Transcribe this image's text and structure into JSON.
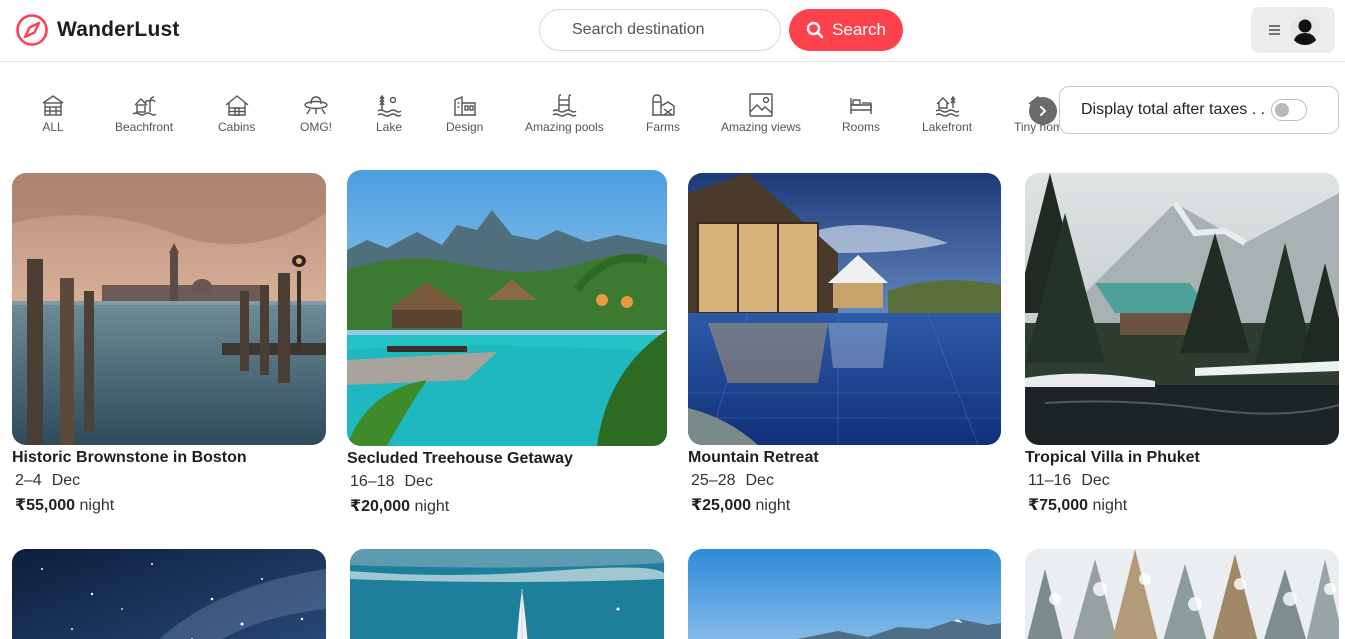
{
  "brand": {
    "name": "WanderLust",
    "icon": "compass-icon",
    "accent": "#fe424d"
  },
  "search": {
    "placeholder": "Search destination",
    "button_label": "Search",
    "icon": "search-icon"
  },
  "user_menu": {
    "menu_icon": "hamburger-icon",
    "avatar_icon": "user-avatar-icon"
  },
  "filters": [
    {
      "label": "ALL",
      "icon": "home-icon"
    },
    {
      "label": "Beachfront",
      "icon": "beachfront-icon"
    },
    {
      "label": "Cabins",
      "icon": "cabin-icon"
    },
    {
      "label": "OMG!",
      "icon": "ufo-icon"
    },
    {
      "label": "Lake",
      "icon": "lake-icon"
    },
    {
      "label": "Design",
      "icon": "design-icon"
    },
    {
      "label": "Amazing pools",
      "icon": "pool-icon"
    },
    {
      "label": "Farms",
      "icon": "farm-icon"
    },
    {
      "label": "Amazing views",
      "icon": "view-icon"
    },
    {
      "label": "Rooms",
      "icon": "bed-icon"
    },
    {
      "label": "Lakefront",
      "icon": "lakefront-icon"
    },
    {
      "label": "Tiny hom",
      "icon": "tiny-home-icon"
    }
  ],
  "tax_toggle": {
    "label": "Display total after taxes . .",
    "checked": false
  },
  "listings": [
    {
      "title": "Historic Brownstone in Boston",
      "dates": "2–4",
      "month": "Dec",
      "price": "₹55,000",
      "unit": "night"
    },
    {
      "title": "Secluded Treehouse Getaway",
      "dates": "16–18",
      "month": "Dec",
      "price": "₹20,000",
      "unit": "night"
    },
    {
      "title": "Mountain Retreat",
      "dates": "25–28",
      "month": "Dec",
      "price": "₹25,000",
      "unit": "night"
    },
    {
      "title": "Tropical Villa in Phuket",
      "dates": "11–16",
      "month": "Dec",
      "price": "₹75,000",
      "unit": "night"
    }
  ]
}
